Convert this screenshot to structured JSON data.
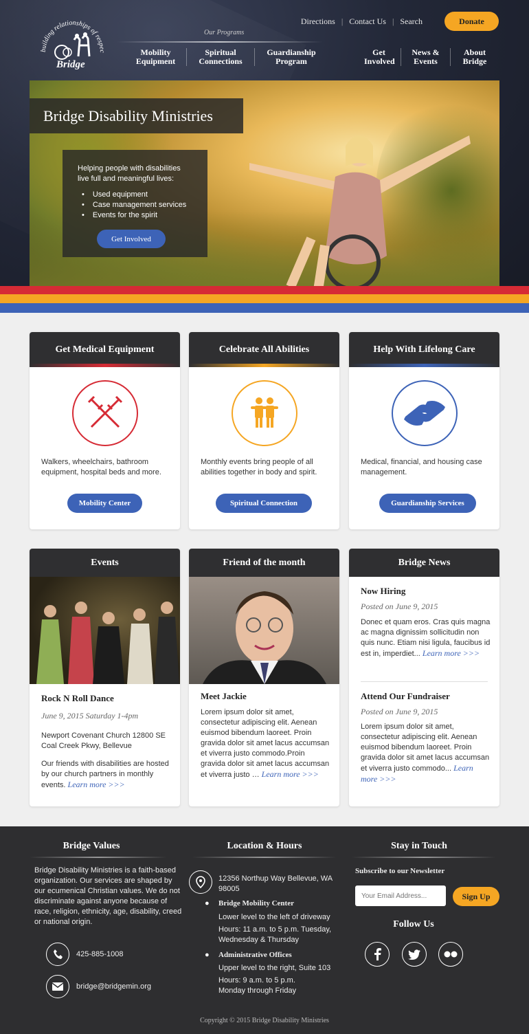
{
  "header": {
    "logo_tagline": "building relationships of respect",
    "logo_word": "Bridge",
    "utility": [
      "Directions",
      "Contact Us",
      "Search"
    ],
    "donate": "Donate",
    "programs_label": "Our Programs",
    "nav_programs": [
      "Mobility\nEquipment",
      "Spiritual\nConnections",
      "Guardianship\nProgram"
    ],
    "nav_other": [
      "Get\nInvolved",
      "News &\nEvents",
      "About\nBridge"
    ]
  },
  "hero": {
    "title": "Bridge Disability Ministries",
    "intro": "Helping people with disabilities live full and meaningful lives:",
    "bullets": [
      "Used equipment",
      "Case management services",
      "Events for the spirit"
    ],
    "button": "Get Involved"
  },
  "services": [
    {
      "title": "Get Medical Equipment",
      "text": "Walkers, wheelchairs, bathroom equipment, hospital beds and more.",
      "button": "Mobility Center",
      "icon": "crutches-icon",
      "color": "#d62b35"
    },
    {
      "title": "Celebrate All Abilities",
      "text": "Monthly events bring people of all abilities together in body and spirit.",
      "button": "Spiritual Connection",
      "icon": "people-icon",
      "color": "#f5a623"
    },
    {
      "title": "Help With Lifelong Care",
      "text": "Medical, financial, and housing case management.",
      "button": "Guardianship Services",
      "icon": "hands-icon",
      "color": "#3d63b7"
    }
  ],
  "events": {
    "heading": "Events",
    "title": "Rock N Roll Dance",
    "date": "June 9, 2015 Saturday 1-4pm",
    "location": "Newport Covenant Church 12800 SE Coal Creek Pkwy, Bellevue",
    "body": "Our friends with disabilities are hosted by our church partners in monthly events.",
    "more": "Learn more >>>"
  },
  "friend": {
    "heading": "Friend of the month",
    "title": "Meet Jackie",
    "body": "Lorem ipsum dolor sit amet, consectetur adipiscing elit. Aenean euismod bibendum laoreet. Proin gravida dolor sit amet lacus accumsan et viverra justo commodo.Proin gravida dolor sit amet lacus accumsan et viverra justo …",
    "more": "Learn more >>>"
  },
  "news": {
    "heading": "Bridge News",
    "items": [
      {
        "title": "Now Hiring",
        "date": "Posted on June 9, 2015",
        "body": "Donec et quam eros. Cras quis magna ac magna dignissim sollicitudin non quis nunc. Etiam nisi ligula, faucibus id est in, imperdiet...",
        "more": "Learn more >>>"
      },
      {
        "title": "Attend Our Fundraiser",
        "date": "Posted on June 9, 2015",
        "body": "Lorem ipsum dolor sit amet, consectetur adipiscing elit. Aenean euismod bibendum laoreet. Proin gravida dolor sit amet lacus accumsan et viverra justo commodo...",
        "more": "Learn more >>>"
      }
    ]
  },
  "footer": {
    "values_heading": "Bridge Values",
    "values_text": "Bridge Disability Ministries is a faith-based organization. Our services are shaped by our ecumenical Christian values. We do not discriminate against anyone because of race, religion, ethnicity, age, disability, creed or national origin.",
    "phone": "425-885-1008",
    "email": "bridge@bridgemin.org",
    "location_heading": "Location & Hours",
    "address": "12356 Northup Way Bellevue, WA 98005",
    "mobility_name": "Bridge Mobility Center",
    "mobility_where": "Lower level to the left of driveway",
    "mobility_hours": "Hours: 11 a.m. to 5 p.m. Tuesday, Wednesday & Thursday",
    "admin_name": "Administrative Offices",
    "admin_where": "Upper level to the right, Suite 103",
    "admin_hours": "Hours: 9 a.m. to 5 p.m. Monday through Friday",
    "touch_heading": "Stay in Touch",
    "newsletter": "Subscribe to our Newsletter",
    "email_placeholder": "Your Email Address...",
    "signup": "Sign Up",
    "follow": "Follow Us",
    "copyright": "Copyright © 2015  Bridge Disability Ministries"
  }
}
